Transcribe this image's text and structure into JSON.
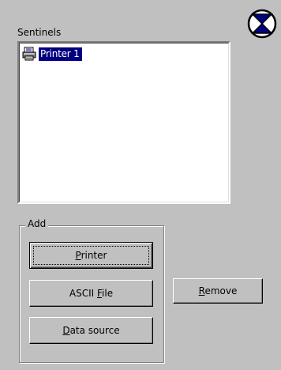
{
  "sentinels": {
    "label": "Sentinels",
    "items": [
      {
        "label": "Printer 1",
        "icon": "printer-icon",
        "selected": true
      }
    ]
  },
  "add_group": {
    "legend": "Add",
    "printer_pre": "",
    "printer_key": "P",
    "printer_post": "rinter",
    "ascii_pre": "ASCII ",
    "ascii_key": "F",
    "ascii_post": "ile",
    "datasource_pre": "",
    "datasource_key": "D",
    "datasource_post": "ata source"
  },
  "actions": {
    "remove_pre": "",
    "remove_key": "R",
    "remove_post": "emove"
  },
  "colors": {
    "window_bg": "#c0c0c0",
    "selection": "#000080",
    "list_bg": "#ffffff"
  }
}
